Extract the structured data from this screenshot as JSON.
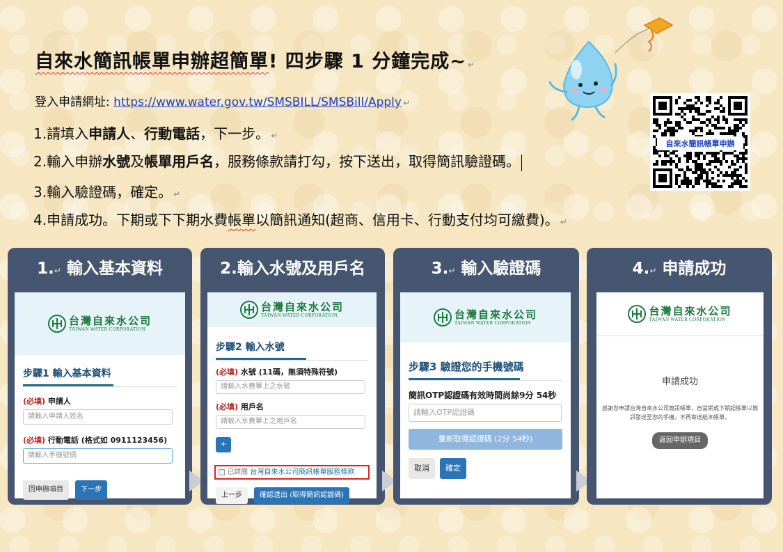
{
  "header": {
    "title_main": "自來水簡訊帳單申辦超簡單",
    "title_sub": "! 四步驟 1 分鐘完成~",
    "url_label": "登入申請網址: ",
    "url": "https://www.water.gov.tw/SMSBILL/SMSBill/Apply",
    "para_mark": "↵"
  },
  "steps": [
    {
      "pre": "1.請填入",
      "b1": "申請人",
      "mid": "、",
      "b2": "行動電話",
      "post": "，下一步。"
    },
    {
      "pre": "2.輸入申辦",
      "b1": "水號",
      "mid": "及",
      "b2": "帳單用戶名",
      "post": "，服務條款請打勾，按下送出，取得簡訊驗證碼。"
    },
    {
      "pre": "3.輸入驗證碼，確定。",
      "b1": "",
      "mid": "",
      "b2": "",
      "post": ""
    },
    {
      "pre": "4.申請成功。下期或下下期水費",
      "b1": "",
      "mid": "帳單",
      "b2": "",
      "post": "以簡訊通知(超商、信用卡、行動支付均可繳費)。"
    }
  ],
  "qr": {
    "label": "自來水簡訊帳單申辦"
  },
  "logo": {
    "zh": "台灣自來水公司",
    "en": "TAIWAN WATER CORPORATION"
  },
  "panels": [
    {
      "num": "1.",
      "title": "輸入基本資料",
      "form_heading": "步驟1 輸入基本資料",
      "field1_req": "(必填)",
      "field1_label": " 申請人",
      "field1_ph": "請輸入申請人姓名",
      "field2_req": "(必填)",
      "field2_label": " 行動電話 (格式如 0911123456)",
      "field2_ph": "請輸入手機號碼",
      "btn_back": "回申辦項目",
      "btn_next": "下一步"
    },
    {
      "num": "2.",
      "title": "輸入水號及用戶名",
      "form_heading": "步驟2 輸入水號",
      "field1_req": "(必填)",
      "field1_label": " 水號 (11碼，無須特殊符號)",
      "field1_ph": "請輸入水費單上之水號",
      "field2_req": "(必填)",
      "field2_label": " 用戶名",
      "field2_ph": "請輸入水費單上之用戶名",
      "plus": "+",
      "terms_pre": "已詳閱 ",
      "terms_link": "台灣自來水公司簡訊帳單服務條款",
      "btn_prev": "上一步",
      "btn_submit": "確認送出 (取得簡訊認證碼)"
    },
    {
      "num": "3.",
      "title": "輸入驗證碼",
      "form_heading": "步驟3 驗證您的手機號碼",
      "otp_label": "簡訊OTP認證碼有效時間尚餘9分 54秒",
      "otp_ph": "請輸入OTP認證碼",
      "btn_resend": "重新取得認證碼 (2分 54秒)",
      "btn_cancel": "取消",
      "btn_ok": "確定"
    },
    {
      "num": "4.",
      "title": "申請成功",
      "success_heading": "申請成功",
      "success_msg": "感謝您申請台灣自來水公司簡訊帳單，自當期或下期起帳單以簡訊發送至您的手機，不再寄送紙本帳單。",
      "btn_return": "返回申辦項目"
    }
  ]
}
